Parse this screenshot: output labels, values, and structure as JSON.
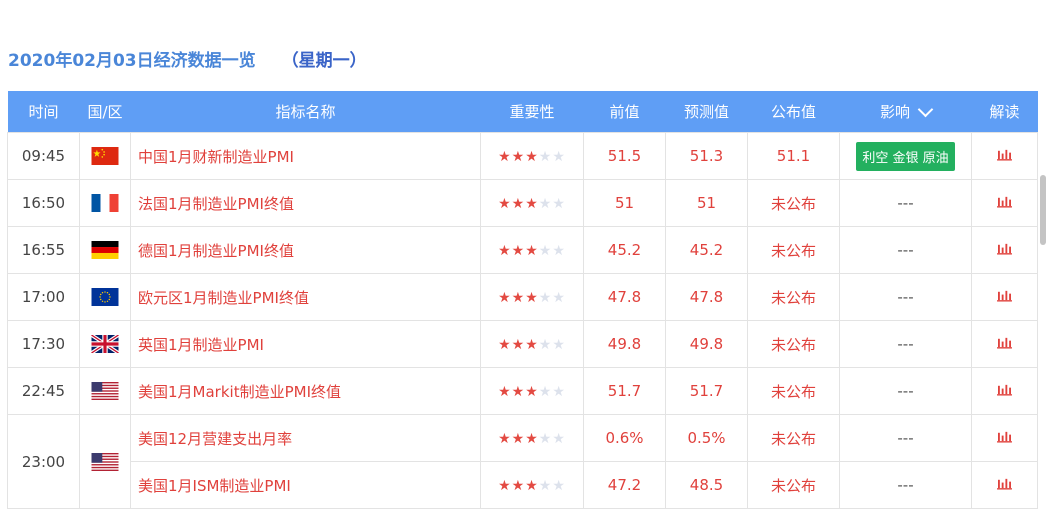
{
  "heading": {
    "title": "2020年02月03日经济数据一览",
    "weekday": "（星期一）"
  },
  "columns": {
    "time": "时间",
    "region": "国/区",
    "indicator": "指标名称",
    "importance": "重要性",
    "previous": "前值",
    "forecast": "预测值",
    "actual": "公布值",
    "impact": "影响",
    "analysis": "解读"
  },
  "colors": {
    "header_bg": "#5f9ef5",
    "value_red": "#e0413c",
    "badge_green": "#23b05f",
    "title_blue": "#4a86d8"
  },
  "rows": [
    {
      "time": "09:45",
      "flag": "china-flag-icon",
      "indicator": "中国1月财新制造业PMI",
      "stars": 3,
      "previous": "51.5",
      "forecast": "51.3",
      "actual": "51.1",
      "impact": "利空 金银 原油"
    },
    {
      "time": "16:50",
      "flag": "france-flag-icon",
      "indicator": "法国1月制造业PMI终值",
      "stars": 3,
      "previous": "51",
      "forecast": "51",
      "actual": "未公布",
      "impact": "---"
    },
    {
      "time": "16:55",
      "flag": "germany-flag-icon",
      "indicator": "德国1月制造业PMI终值",
      "stars": 3,
      "previous": "45.2",
      "forecast": "45.2",
      "actual": "未公布",
      "impact": "---"
    },
    {
      "time": "17:00",
      "flag": "eu-flag-icon",
      "indicator": "欧元区1月制造业PMI终值",
      "stars": 3,
      "previous": "47.8",
      "forecast": "47.8",
      "actual": "未公布",
      "impact": "---"
    },
    {
      "time": "17:30",
      "flag": "uk-flag-icon",
      "indicator": "英国1月制造业PMI",
      "stars": 3,
      "previous": "49.8",
      "forecast": "49.8",
      "actual": "未公布",
      "impact": "---"
    },
    {
      "time": "22:45",
      "flag": "us-flag-icon",
      "indicator": "美国1月Markit制造业PMI终值",
      "stars": 3,
      "previous": "51.7",
      "forecast": "51.7",
      "actual": "未公布",
      "impact": "---"
    },
    {
      "time": "23:00",
      "flag": "us-flag-icon",
      "indicator": "美国12月营建支出月率",
      "stars": 3,
      "previous": "0.6%",
      "forecast": "0.5%",
      "actual": "未公布",
      "impact": "---"
    },
    {
      "time": "",
      "flag": "",
      "indicator": "美国1月ISM制造业PMI",
      "stars": 3,
      "previous": "47.2",
      "forecast": "48.5",
      "actual": "未公布",
      "impact": "---"
    }
  ]
}
